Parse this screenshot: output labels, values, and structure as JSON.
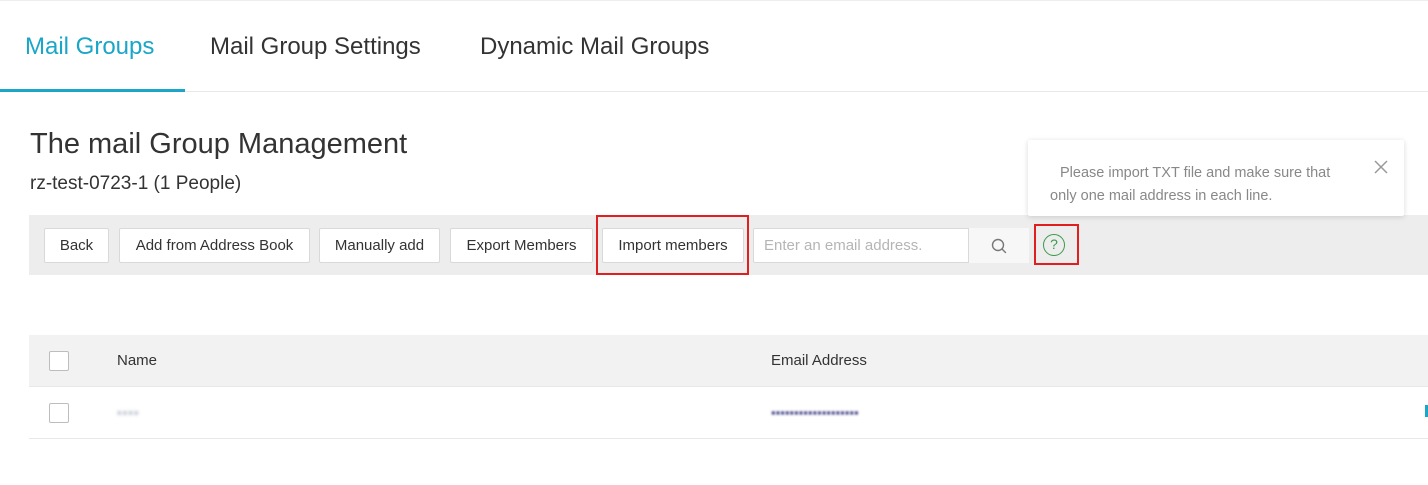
{
  "tabs": [
    {
      "label": "Mail Groups",
      "active": true
    },
    {
      "label": "Mail Group Settings",
      "active": false
    },
    {
      "label": "Dynamic Mail Groups",
      "active": false
    }
  ],
  "page": {
    "title": "The mail Group Management",
    "group_summary": "rz-test-0723-1 (1 People)"
  },
  "toolbar": {
    "back_label": "Back",
    "add_from_address_book_label": "Add from Address Book",
    "manually_add_label": "Manually add",
    "export_members_label": "Export Members",
    "import_members_label": "Import members",
    "search_placeholder": "Enter an email address.",
    "search_icon": "search-icon",
    "help_icon": "question-circle-icon",
    "help_glyph": "?"
  },
  "tooltip": {
    "text": "Please import TXT file and make sure that only one mail address in each line.",
    "close_icon": "close-icon"
  },
  "table": {
    "columns": [
      "Name",
      "Email Address"
    ],
    "rows": [
      {
        "name": "▪▪▪▪",
        "email": "▪▪▪▪▪▪▪▪▪▪▪▪▪▪▪▪▪▪▪"
      }
    ]
  },
  "colors": {
    "accent": "#1aa6c8",
    "highlight_border": "#e02020",
    "help_icon": "#3a9a4a",
    "toolbar_bg": "#ededed"
  }
}
